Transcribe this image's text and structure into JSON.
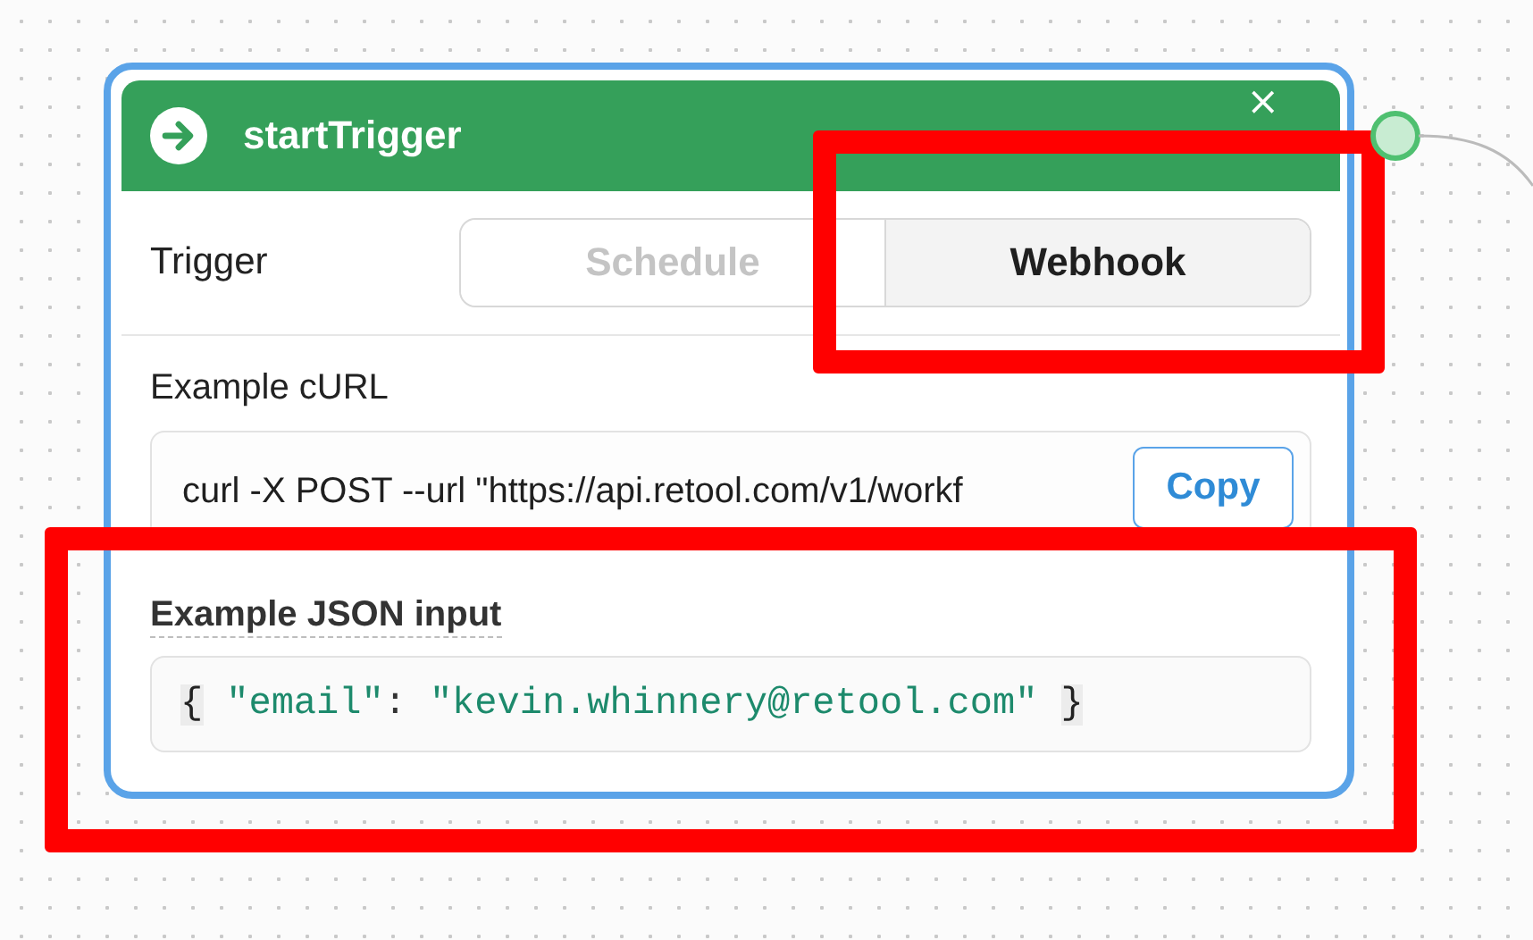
{
  "node": {
    "title": "startTrigger",
    "close_glyph": "×",
    "connected": true,
    "trigger": {
      "label": "Trigger",
      "options": [
        {
          "label": "Schedule",
          "selected": false,
          "highlighted": false
        },
        {
          "label": "Webhook",
          "selected": true,
          "highlighted": true
        }
      ]
    },
    "curl": {
      "label": "Example cURL",
      "value": "curl -X POST --url \"https://api.retool.com/v1/workf",
      "button": "Copy"
    },
    "json_input": {
      "label": "Example JSON input",
      "highlighted": true,
      "tokens": [
        {
          "text": "{",
          "kind": "brace"
        },
        {
          "text": "\"email\"",
          "kind": "string"
        },
        {
          "text": ":",
          "kind": "punct"
        },
        {
          "text": "\"kevin.whinnery@retool.com\"",
          "kind": "string"
        },
        {
          "text": "}",
          "kind": "brace"
        }
      ]
    }
  }
}
